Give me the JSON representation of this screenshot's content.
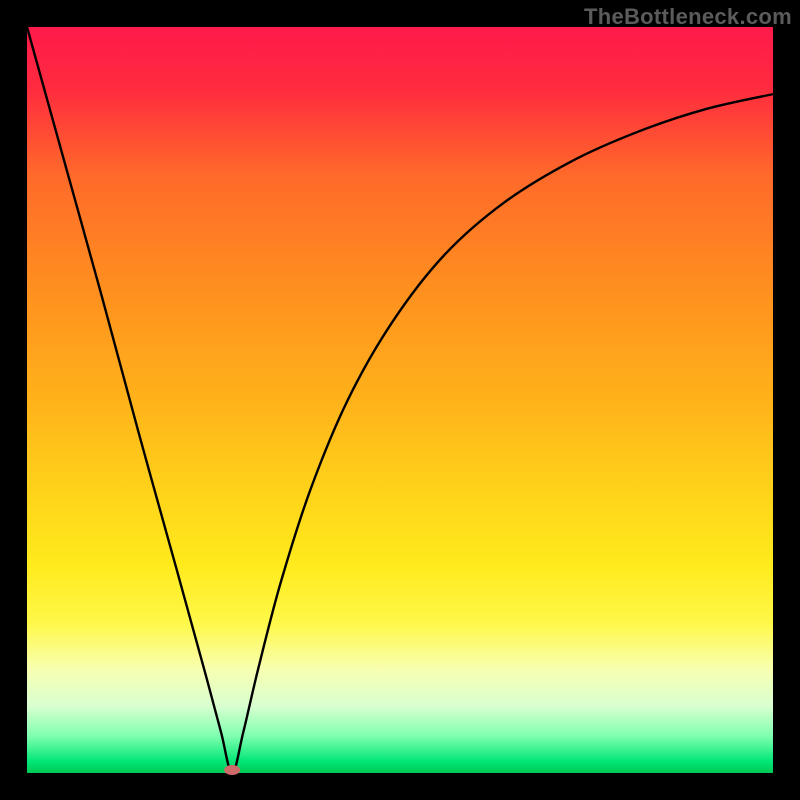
{
  "watermark": "TheBottleneck.com",
  "colors": {
    "frame": "#000000",
    "curve": "#000000",
    "marker": "#cf6a6a",
    "gradient_stops": [
      {
        "offset": 0.0,
        "color": "#ff1a4b"
      },
      {
        "offset": 0.08,
        "color": "#ff2a3f"
      },
      {
        "offset": 0.2,
        "color": "#ff6a2a"
      },
      {
        "offset": 0.35,
        "color": "#ff8f1f"
      },
      {
        "offset": 0.5,
        "color": "#ffb21a"
      },
      {
        "offset": 0.62,
        "color": "#ffd21a"
      },
      {
        "offset": 0.72,
        "color": "#ffea1c"
      },
      {
        "offset": 0.8,
        "color": "#fff84a"
      },
      {
        "offset": 0.86,
        "color": "#f8ffb0"
      },
      {
        "offset": 0.91,
        "color": "#d9ffd0"
      },
      {
        "offset": 0.95,
        "color": "#80ffb0"
      },
      {
        "offset": 0.985,
        "color": "#00e676"
      },
      {
        "offset": 1.0,
        "color": "#00c853"
      }
    ]
  },
  "frame": {
    "outer": 800,
    "border": 27
  },
  "marker": {
    "x": 0.275,
    "rx": 8,
    "ry": 5
  },
  "chart_data": {
    "type": "line",
    "title": "",
    "xlabel": "",
    "ylabel": "",
    "xlim": [
      0,
      1
    ],
    "ylim": [
      0,
      1
    ],
    "note": "x is normalized horizontal position across the plot; y is normalized height (0 = bottom/green, 1 = top/red). Bottleneck-style V-curve with minimum at x≈0.275.",
    "series": [
      {
        "name": "bottleneck-curve",
        "x": [
          0.0,
          0.05,
          0.1,
          0.15,
          0.2,
          0.24,
          0.26,
          0.275,
          0.29,
          0.31,
          0.34,
          0.38,
          0.43,
          0.49,
          0.56,
          0.64,
          0.73,
          0.82,
          0.91,
          1.0
        ],
        "y": [
          1.0,
          0.82,
          0.64,
          0.455,
          0.275,
          0.13,
          0.055,
          0.0,
          0.055,
          0.14,
          0.255,
          0.38,
          0.5,
          0.605,
          0.695,
          0.765,
          0.82,
          0.86,
          0.89,
          0.91
        ]
      }
    ],
    "minimum_marker": {
      "x": 0.275,
      "y": 0.0
    }
  }
}
